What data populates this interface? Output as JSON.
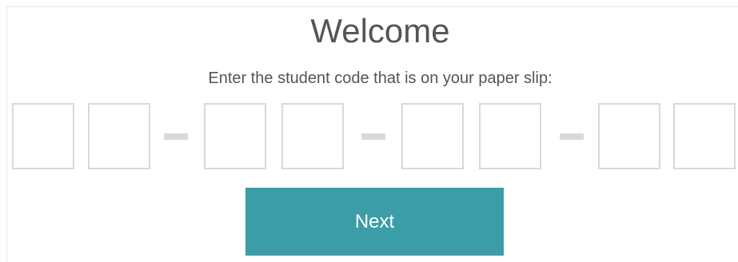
{
  "welcome": {
    "title": "Welcome",
    "instructions": "Enter the student code that is on your paper slip:"
  },
  "code": {
    "box1": "",
    "box2": "",
    "box3": "",
    "box4": "",
    "box5": "",
    "box6": "",
    "box7": "",
    "box8": ""
  },
  "actions": {
    "next_label": "Next"
  },
  "colors": {
    "title_text": "#555555",
    "box_border": "#d9d9d9",
    "button_bg": "#3b9da8",
    "button_text": "#ffffff"
  }
}
